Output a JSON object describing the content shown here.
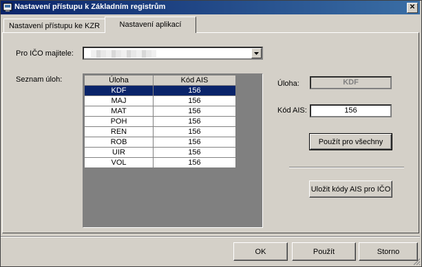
{
  "window": {
    "title": "Nastavení přístupu k Základním registrům"
  },
  "tabs": [
    {
      "label": "Nastavení přístupu ke KZR"
    },
    {
      "label": "Nastavení aplikací",
      "active": true
    }
  ],
  "form": {
    "ico_label": "Pro IČO majitele:",
    "task_list_label": "Seznam úloh:",
    "grid": {
      "columns": [
        "Úloha",
        "Kód AIS"
      ],
      "rows": [
        [
          "KDF",
          "156"
        ],
        [
          "MAJ",
          "156"
        ],
        [
          "MAT",
          "156"
        ],
        [
          "POH",
          "156"
        ],
        [
          "REN",
          "156"
        ],
        [
          "ROB",
          "156"
        ],
        [
          "UIR",
          "156"
        ],
        [
          "VOL",
          "156"
        ]
      ],
      "selected_index": 0
    },
    "task_label": "Úloha:",
    "task_value": "KDF",
    "ais_label": "Kód AIS:",
    "ais_value": "156",
    "apply_all_label": "Použít pro všechny",
    "save_ais_label": "Uložit kódy AIS pro IČO"
  },
  "footer": {
    "ok_label": "OK",
    "apply_label": "Použít",
    "cancel_label": "Storno"
  }
}
